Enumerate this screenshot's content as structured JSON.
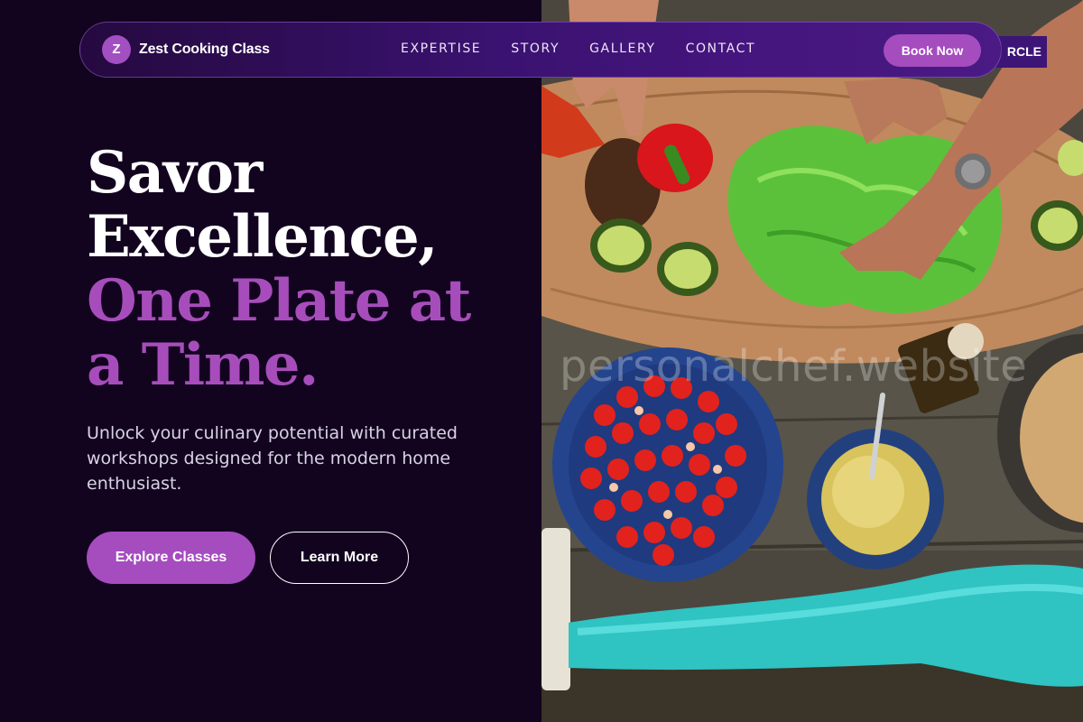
{
  "brand": {
    "initial": "Z",
    "name": "Zest Cooking Class"
  },
  "nav": {
    "links": [
      "EXPERTISE",
      "STORY",
      "GALLERY",
      "CONTACT"
    ],
    "cta": "Book Now"
  },
  "hero": {
    "title_line1": "Savor",
    "title_line2": "Excellence,",
    "title_line3": "One Plate at",
    "title_line4": "a Time.",
    "subtitle": "Unlock your culinary potential with curated workshops designed for the modern home enthusiast.",
    "primary_cta": "Explore Classes",
    "secondary_cta": "Learn More"
  },
  "photo": {
    "watermark": "personalchef.website",
    "overflow_tag": "RCLE"
  },
  "colors": {
    "background": "#12041f",
    "accent": "#a54cbf",
    "nav_gradient_end": "#4b1a84"
  }
}
